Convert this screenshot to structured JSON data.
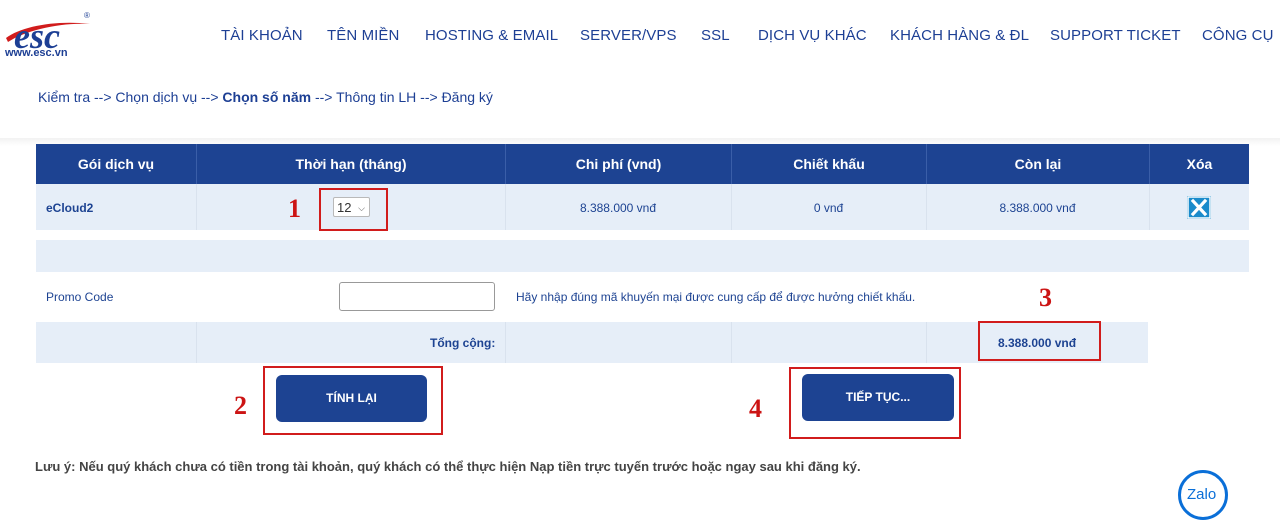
{
  "header": {
    "logo_alt": "esc",
    "logo_url_text": "www.esc.vn",
    "nav": [
      "TÀI KHOẢN",
      "TÊN MIỀN",
      "HOSTING & EMAIL",
      "SERVER/VPS",
      "SSL",
      "DỊCH VỤ KHÁC",
      "KHÁCH HÀNG & ĐL",
      "SUPPORT TICKET",
      "CÔNG CỤ"
    ]
  },
  "breadcrumb": {
    "step1": "Kiểm tra",
    "step2": "Chọn dịch vụ",
    "step3": "Chọn số năm",
    "step4": "Thông tin LH",
    "step5": "Đăng ký",
    "separator": "-->"
  },
  "table": {
    "headers": [
      "Gói dịch vụ",
      "Thời hạn (tháng)",
      "Chi phí (vnd)",
      "Chiết khấu",
      "Còn lại",
      "Xóa"
    ],
    "rows": [
      {
        "package": "eCloud2",
        "term": "12",
        "cost": "8.388.000 vnđ",
        "discount": "0 vnđ",
        "remaining": "8.388.000 vnđ"
      }
    ]
  },
  "promo": {
    "label": "Promo Code",
    "value": "",
    "hint": "Hãy nhập đúng mã khuyến mại được cung cấp để được hưởng chiết khấu."
  },
  "total": {
    "label": "Tổng cộng:",
    "value": "8.388.000 vnđ"
  },
  "buttons": {
    "recalc": "TÍNH LẠI",
    "continue": "TIẾP TỤC..."
  },
  "annotations": [
    "1",
    "2",
    "3",
    "4"
  ],
  "note": "Lưu ý: Nếu quý khách chưa có tiền trong tài khoản, quý khách có thể thực hiện Nạp tiền trực tuyến trước hoặc ngay sau khi đăng ký.",
  "zalo": {
    "label": "Zalo"
  },
  "colors": {
    "brand_blue": "#1d4392",
    "row_bg": "#e6eef8",
    "annotation_red": "#d11c1c",
    "delete_blue": "#1a8bcb"
  }
}
